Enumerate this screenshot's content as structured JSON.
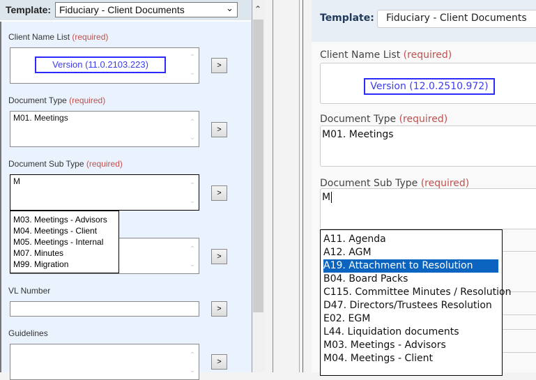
{
  "left_panel": {
    "template_label": "Template:",
    "template_value": "Fiduciary - Client Documents",
    "required": "(required)",
    "client_name_label": "Client Name List",
    "version": "Version (11.0.2103.223)",
    "document_type_label": "Document Type",
    "document_type_value": "M01. Meetings",
    "sub_type_label": "Document Sub Type",
    "sub_type_value": "M",
    "vl_number_label": "VL Number",
    "guidelines_label": "Guidelines",
    "button_label": ">",
    "dropdown_options": [
      "M03. Meetings - Advisors",
      "M04. Meetings - Client",
      "M05. Meetings - Internal",
      "M07. Minutes",
      "M99. Migration"
    ]
  },
  "right_panel": {
    "template_label": "Template:",
    "template_value": "Fiduciary - Client Documents",
    "required": "(required)",
    "client_name_label": "Client Name List",
    "version": "Version (12.0.2510.972)",
    "document_type_label": "Document Type",
    "document_type_value": "M01. Meetings",
    "sub_type_label": "Document Sub Type",
    "sub_type_value": "M",
    "dropdown_options": [
      "A11. Agenda",
      "A12. AGM",
      "A19. Attachment to Resolution",
      "B04. Board Packs",
      "C115. Committee Minutes / Resolution",
      "D47. Directors/Trustees Resolution",
      "E02. EGM",
      "L44. Liquidation documents",
      "M03. Meetings - Advisors",
      "M04. Meetings - Client"
    ],
    "selected_option": "A19. Attachment to Resolution"
  },
  "colors": {
    "highlight": "#0a64c0",
    "required": "#c0504d",
    "version_border": "#2b2bff"
  }
}
